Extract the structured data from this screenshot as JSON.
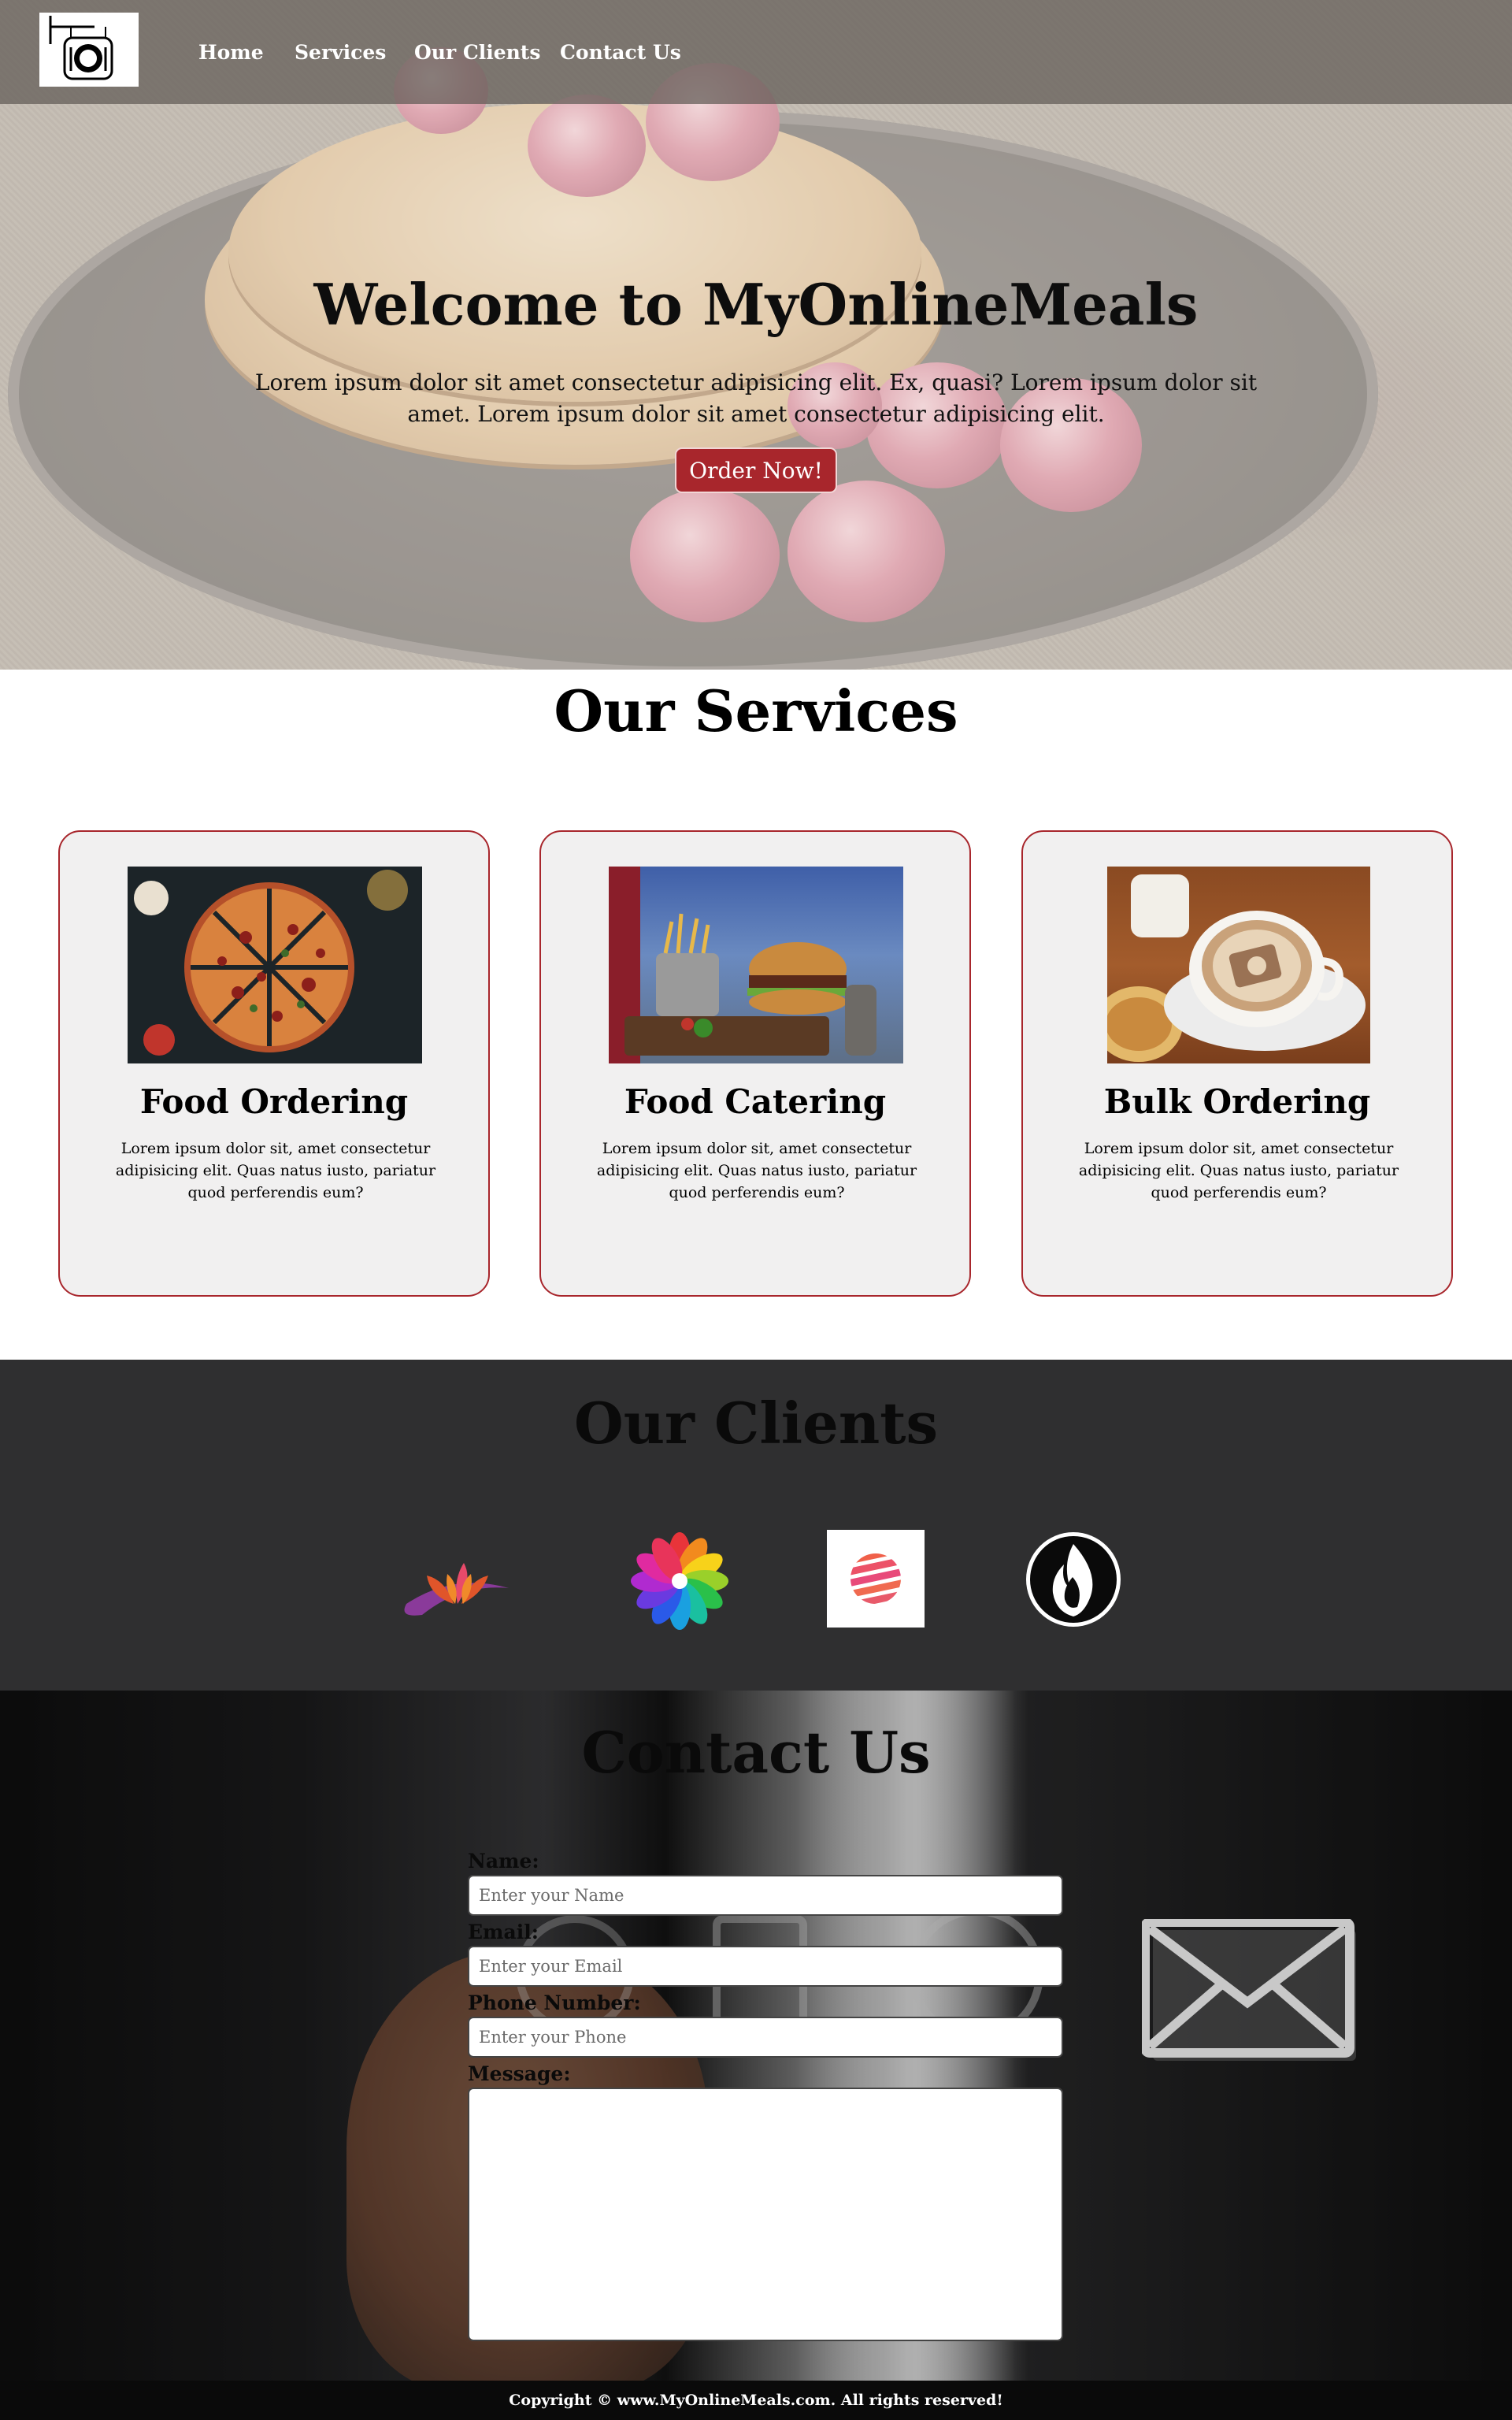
{
  "nav": {
    "logo": "restaurant-sign-logo",
    "links": [
      "Home",
      "Services",
      "Our Clients",
      "Contact Us"
    ]
  },
  "hero": {
    "title": "Welcome to MyOnlineMeals",
    "subtitle": "Lorem ipsum dolor sit amet consectetur adipisicing elit. Ex, quasi? Lorem ipsum dolor sit amet. Lorem ipsum dolor sit amet consectetur adipisicing elit.",
    "button": "Order Now!"
  },
  "services": {
    "title": "Our Services",
    "cards": [
      {
        "title": "Food Ordering",
        "text": "Lorem ipsum dolor sit, amet consectetur adipisicing elit. Quas natus iusto, pariatur quod perferendis eum?",
        "image": "pizza-photo"
      },
      {
        "title": "Food Catering",
        "text": "Lorem ipsum dolor sit, amet consectetur adipisicing elit. Quas natus iusto, pariatur quod perferendis eum?",
        "image": "burger-fries-photo"
      },
      {
        "title": "Bulk Ordering",
        "text": "Lorem ipsum dolor sit, amet consectetur adipisicing elit. Quas natus iusto, pariatur quod perferendis eum?",
        "image": "coffee-cup-photo"
      }
    ]
  },
  "clients": {
    "title": "Our Clients",
    "logos": [
      "lotus-logo",
      "flower-pinwheel-logo",
      "striped-sphere-logo",
      "flame-logo"
    ]
  },
  "contact": {
    "title": "Contact Us",
    "name_label": "Name:",
    "name_placeholder": "Enter your Name",
    "email_label": "Email:",
    "email_placeholder": "Enter your Email",
    "phone_label": "Phone Number:",
    "phone_placeholder": "Enter your Phone",
    "message_label": "Message:"
  },
  "footer": {
    "text": "Copyright © www.MyOnlineMeals.com. All rights reserved!"
  },
  "colors": {
    "accent": "#a8262c",
    "card_bg": "#f1f0f0",
    "clients_bg": "#2f2f30",
    "footer_bg": "#0a0a0a"
  }
}
